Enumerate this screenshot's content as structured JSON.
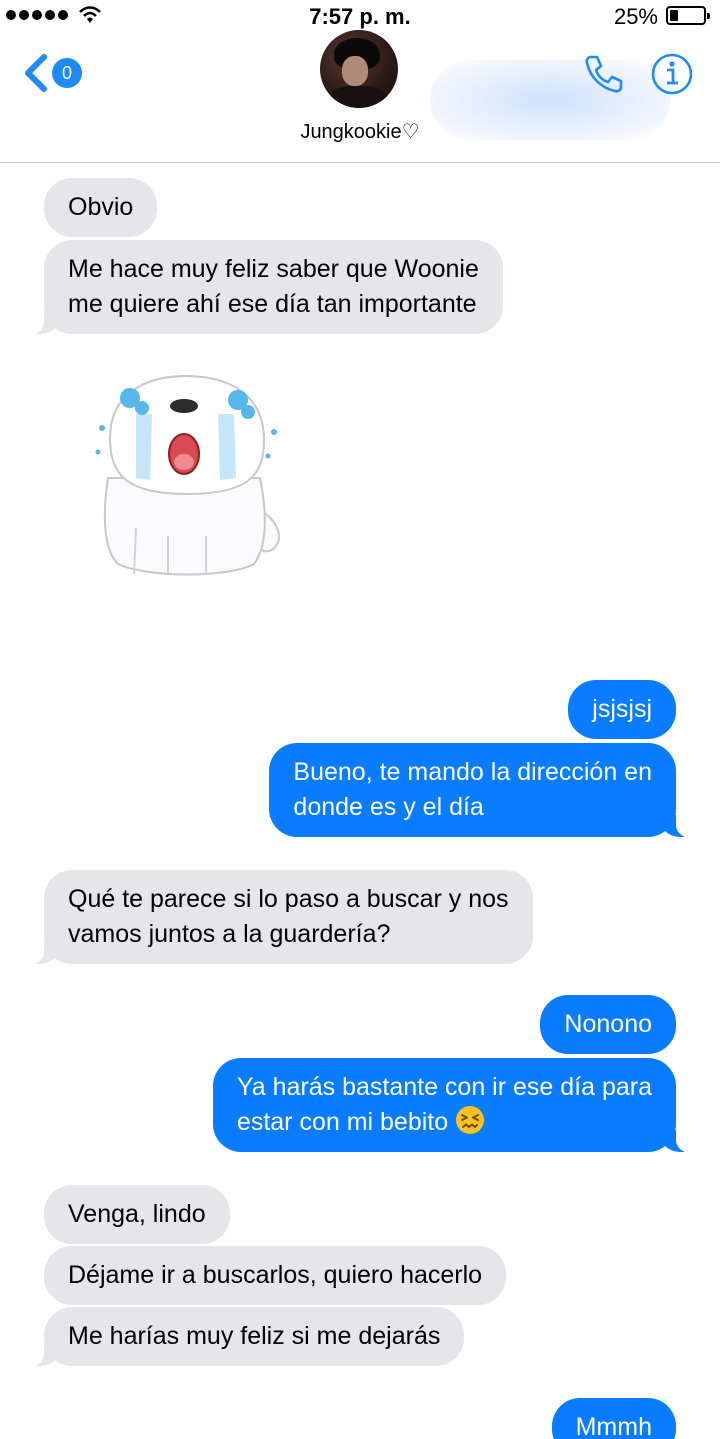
{
  "status_bar": {
    "time": "7:57 p. m.",
    "battery_percent": "25%",
    "battery_level": 0.25,
    "signal_bars": 5
  },
  "header": {
    "back_badge": "0",
    "contact_name": "Jungkookie♡",
    "icons": [
      "back-chevron-icon",
      "phone-icon",
      "info-icon"
    ],
    "accent_color": "#1f8bf7"
  },
  "messages": [
    {
      "from": "contact",
      "text": "Obvio"
    },
    {
      "from": "contact",
      "text": "Me hace muy feliz saber que Woonie",
      "text2": "me quiere ahí ese día tan importante"
    },
    {
      "from": "contact",
      "sticker": "crying-white-dog-sticker"
    },
    {
      "from": "me",
      "text": "jsjsjsj"
    },
    {
      "from": "me",
      "text": "Bueno, te mando la dirección en",
      "text2": "donde es y el día"
    },
    {
      "from": "contact",
      "text": "Qué te parece si lo paso a buscar y nos",
      "text2": "vamos juntos a la guardería?"
    },
    {
      "from": "me",
      "text": "Nonono"
    },
    {
      "from": "me",
      "text": "Ya harás bastante con ir ese día para",
      "text2": "estar con mi bebito",
      "emoji": "confounded-face-emoji"
    },
    {
      "from": "contact",
      "text": "Venga, lindo"
    },
    {
      "from": "contact",
      "text": "Déjame ir a buscarlos, quiero hacerlo"
    },
    {
      "from": "contact",
      "text": "Me harías muy feliz si me dejarás"
    },
    {
      "from": "me",
      "text": "Mmmh"
    }
  ],
  "colors": {
    "incoming_bubble": "#e5e5ea",
    "outgoing_bubble": "#0a7cff"
  }
}
